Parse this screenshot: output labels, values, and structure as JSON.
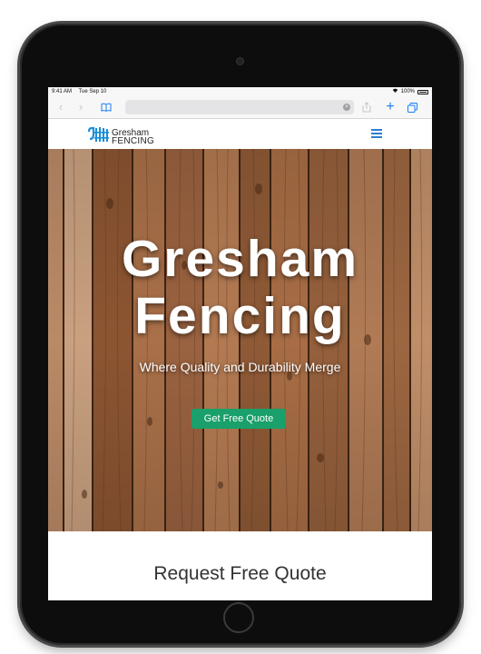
{
  "status_bar": {
    "time": "9:41 AM",
    "date": "Tue Sep 10",
    "battery": "100%"
  },
  "browser": {
    "icons": [
      "back-chevron",
      "forward-chevron",
      "bookmarks-book",
      "clear-x",
      "share",
      "new-tab-plus",
      "tabs-overview"
    ]
  },
  "site_nav": {
    "logo_line1": "Gresham",
    "logo_line2": "FENCING",
    "menu_icon": "hamburger"
  },
  "hero": {
    "title_line1": "Gresham",
    "title_line2": "Fencing",
    "subtitle": "Where Quality and Durability Merge",
    "cta_label": "Get Free Quote"
  },
  "quote_section": {
    "title": "Request Free Quote"
  },
  "colors": {
    "accent": "#1aa06a",
    "link_blue": "#1a7cf3",
    "logo_blue": "#1a8fd6",
    "wood": "#8a5a36"
  }
}
